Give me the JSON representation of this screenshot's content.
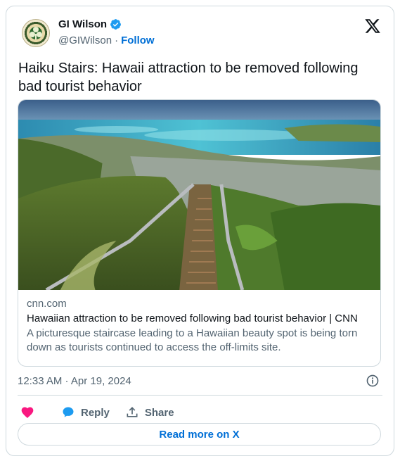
{
  "author": {
    "name": "GI Wilson",
    "handle": "@GIWilson",
    "separator": "·",
    "follow_label": "Follow"
  },
  "tweet": {
    "text": "Haiku Stairs: Hawaii attraction to be removed following bad tourist behavior"
  },
  "link_card": {
    "domain": "cnn.com",
    "title": "Hawaiian attraction to be removed following bad tourist behavior | CNN",
    "description": "A picturesque staircase leading to a Hawaiian beauty spot is being torn down as tourists continued to access the off-limits site."
  },
  "meta": {
    "timestamp": "12:33 AM · Apr 19, 2024"
  },
  "actions": {
    "reply_label": "Reply",
    "share_label": "Share"
  },
  "read_more_label": "Read more on X",
  "colors": {
    "accent": "#006fd6",
    "like": "#f91880",
    "reply_icon": "#1d9bf0",
    "muted": "#536471",
    "border": "#cfd9de"
  },
  "icons": [
    "verified-badge-icon",
    "x-logo-icon",
    "info-icon",
    "heart-icon",
    "reply-bubble-icon",
    "share-icon"
  ]
}
